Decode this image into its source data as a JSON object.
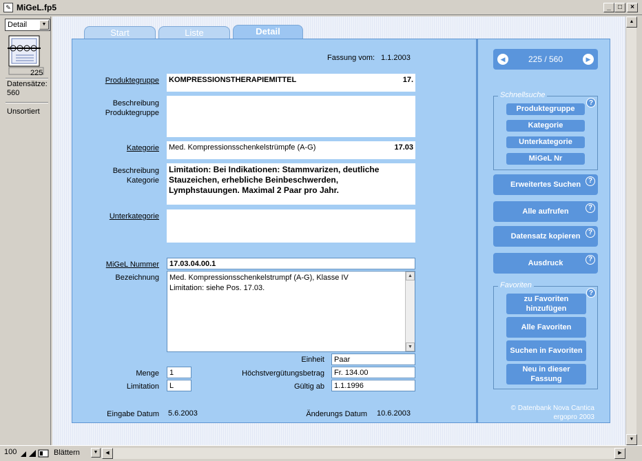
{
  "window": {
    "title": "MiGeL.fp5",
    "minimize": "_",
    "maximize": "□",
    "close": "×"
  },
  "left": {
    "layout": "Detail",
    "record_number": "225",
    "records_label": "Datensätze:",
    "records_count": "560",
    "sort_status": "Unsortiert"
  },
  "tabs": [
    {
      "label": "Start"
    },
    {
      "label": "Liste"
    },
    {
      "label": "Detail"
    }
  ],
  "detail": {
    "fassung_label": "Fassung vom:",
    "fassung_value": "1.1.2003",
    "produktegruppe_label": "Produktegruppe",
    "produktegruppe_value": "KOMPRESSIONSTHERAPIEMITTEL",
    "produktegruppe_code": "17.",
    "beschreibung_pg_label1": "Beschreibung",
    "beschreibung_pg_label2": "Produktegruppe",
    "beschreibung_pg_value": "",
    "kategorie_label": "Kategorie",
    "kategorie_value": "Med. Kompressionsschenkelstrümpfe (A-G)",
    "kategorie_code": "17.03",
    "beschreibung_kat_label1": "Beschreibung",
    "beschreibung_kat_label2": "Kategorie",
    "beschreibung_kat_line1": "Limitation: Bei Indikationen: Stammvarizen, deutliche",
    "beschreibung_kat_line2": "Stauzeichen, erhebliche Beinbeschwerden,",
    "beschreibung_kat_line3": "Lymphstauungen. Maximal 2 Paar pro Jahr.",
    "unterkategorie_label": "Unterkategorie",
    "unterkategorie_value": "",
    "migel_label": "MiGeL Nummer",
    "migel_value": "17.03.04.00.1",
    "bezeichnung_label": "Bezeichnung",
    "bezeichnung_line1": "Med. Kompressionsschenkelstrumpf (A-G), Klasse IV",
    "bezeichnung_line2": "Limitation: siehe Pos. 17.03.",
    "einheit_label": "Einheit",
    "einheit_value": "Paar",
    "menge_label": "Menge",
    "menge_value": "1",
    "hvb_label": "Höchstvergütungsbetrag",
    "hvb_value": "Fr. 134.00",
    "limitation_label": "Limitation",
    "limitation_value": "L",
    "gueltig_label": "Gültig ab",
    "gueltig_value": "1.1.1996",
    "eingabe_label": "Eingabe Datum",
    "eingabe_value": "5.6.2003",
    "aenderung_label": "Änderungs Datum",
    "aenderung_value": "10.6.2003"
  },
  "side": {
    "nav_text": "225 / 560",
    "schnellsuche_title": "Schnellsuche",
    "btn_produktegruppe": "Produktegruppe",
    "btn_kategorie": "Kategorie",
    "btn_unterkategorie": "Unterkategorie",
    "btn_migel": "MiGeL Nr",
    "btn_erweitert": "Erweitertes Suchen",
    "btn_alle": "Alle aufrufen",
    "btn_kopieren": "Datensatz kopieren",
    "btn_ausdruck": "Ausdruck",
    "favoriten_title": "Favoriten",
    "fav_add_line1": "zu Favoriten",
    "fav_add_line2": "hinzufügen",
    "fav_alle": "Alle Favoriten",
    "fav_suchen": "Suchen in Favoriten",
    "fav_neu_line1": "Neu in dieser",
    "fav_neu_line2": "Fassung",
    "help": "?",
    "copyright1": "© Datenbank Nova Cantica",
    "copyright2": "ergopro 2003"
  },
  "status": {
    "zoom": "100",
    "mode": "Blättern"
  }
}
